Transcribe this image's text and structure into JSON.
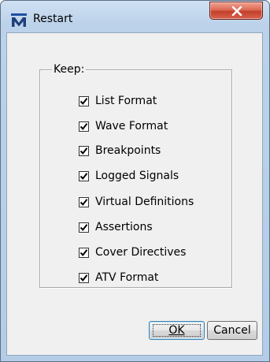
{
  "window": {
    "title": "Restart",
    "app_icon": "modelsim-m-icon",
    "close_icon": "close-x-icon"
  },
  "group": {
    "label": "Keep:"
  },
  "options": [
    {
      "label": "List Format",
      "checked": true
    },
    {
      "label": "Wave Format",
      "checked": true
    },
    {
      "label": "Breakpoints",
      "checked": true
    },
    {
      "label": "Logged Signals",
      "checked": true
    },
    {
      "label": "Virtual Definitions",
      "checked": true
    },
    {
      "label": "Assertions",
      "checked": true
    },
    {
      "label": "Cover Directives",
      "checked": true
    },
    {
      "label": "ATV Format",
      "checked": true
    }
  ],
  "buttons": {
    "ok_label": "OK",
    "cancel_label": "Cancel"
  },
  "colors": {
    "titlebar": "#bcd2ea",
    "close_button": "#c2402c",
    "dialog_background": "#f0f0f0"
  }
}
